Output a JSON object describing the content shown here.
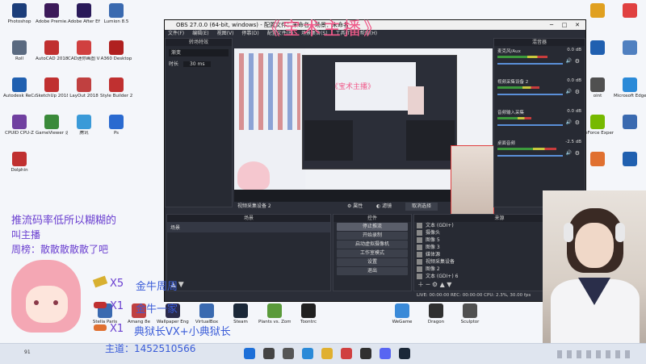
{
  "desktop_icons_left": [
    {
      "label": "Photoshop",
      "color": "#1b3d7a"
    },
    {
      "label": "Adobe Premie...",
      "color": "#3c1a5a"
    },
    {
      "label": "Adobe After Effects 2020",
      "color": "#2a1a5a"
    },
    {
      "label": "Lumion 8.5",
      "color": "#3a6ab0"
    },
    {
      "label": "Roll",
      "color": "#5a6a80"
    },
    {
      "label": "AutoCAD 2018 - Si...",
      "color": "#c03030"
    },
    {
      "label": "CAD迷你画图 V3.0",
      "color": "#d04040"
    },
    {
      "label": "A360 Desktop",
      "color": "#b02020"
    },
    {
      "label": "Autodesk ReCap 2018",
      "color": "#2060b0"
    },
    {
      "label": "SketchUp 2018",
      "color": "#c03030"
    },
    {
      "label": "LayOut 2018",
      "color": "#c04040"
    },
    {
      "label": "Style Builder 2018",
      "color": "#c03030"
    },
    {
      "label": "CPUID CPU-Z",
      "color": "#7040a0"
    },
    {
      "label": "GameViewer 远程",
      "color": "#3a8a3a"
    },
    {
      "label": "腾讯",
      "color": "#3a9ad8"
    },
    {
      "label": "Ps",
      "color": "#2a6ad0"
    },
    {
      "label": "Dolphin",
      "color": "#c03030"
    }
  ],
  "desktop_icons_right": [
    {
      "label": "",
      "color": "#e0a020"
    },
    {
      "label": "",
      "color": "#e04040"
    },
    {
      "label": "",
      "color": "#2060b0"
    },
    {
      "label": "",
      "color": "#5080c0"
    },
    {
      "label": "oint",
      "color": "#505050"
    },
    {
      "label": "Microsoft Edge",
      "color": "#2a8ad8"
    },
    {
      "label": "GeForce Experience",
      "color": "#76b900"
    },
    {
      "label": "",
      "color": "#3a6ab0"
    },
    {
      "label": "",
      "color": "#e07030"
    },
    {
      "label": "",
      "color": "#2060b0"
    }
  ],
  "desktop_icons_bottom": [
    {
      "label": "Stella Paris",
      "color": "#3a6ab0"
    },
    {
      "label": "Amang 8e",
      "color": "#c04040"
    },
    {
      "label": "Wallpaper Engine",
      "color": "#2a2a4a"
    },
    {
      "label": "VirtualBox",
      "color": "#3a6ab0"
    },
    {
      "label": "Steam",
      "color": "#1b2838"
    },
    {
      "label": "Plants vs. Zombies...",
      "color": "#5a9a3a"
    },
    {
      "label": "Toontrc",
      "color": "#202020"
    },
    {
      "label": "WeGame",
      "color": "#3a8ad8"
    },
    {
      "label": "Dragon",
      "color": "#303030"
    },
    {
      "label": "Sculptor",
      "color": "#505050"
    }
  ],
  "overlay": {
    "room_title": "《宝术主播》",
    "room_title_small": "《宝术主播》",
    "line1": "推流码率低所以糊糊的",
    "line2": "叫主播",
    "line3": "周榜：散散散散散了吧",
    "gift1_count": "X5",
    "gift1_text": "金牛周周",
    "gift2_count": "X1",
    "gift2_text": "金牛一家",
    "gift3_count": "X1",
    "gift3_text": "典狱长VX+小典狱长",
    "room_id": "主道：1452510566"
  },
  "obs": {
    "title": "OBS 27.0.0 (64-bit, windows) - 配置文件：未命名 - 场景：未命名",
    "menu": [
      "文件(F)",
      "编辑(E)",
      "视图(V)",
      "停靠(D)",
      "配置文件(P)",
      "场景集合(S)",
      "工具(T)",
      "帮助(H)"
    ],
    "transition_panel_title": "转场特效",
    "transition_value": "渐变",
    "duration_label": "时长",
    "duration_value": "30 ms",
    "mixer_title": "混音器",
    "mixer": [
      {
        "name": "麦克风/Aux",
        "db": "0.0 dB",
        "level": 0.6
      },
      {
        "name": "视频采集设备 2",
        "db": "0.0 dB",
        "level": 0.5
      },
      {
        "name": "音频输入采集",
        "db": "0.0 dB",
        "level": 0.4
      },
      {
        "name": "桌面音频",
        "db": "-2.5 dB",
        "level": 0.7
      }
    ],
    "source_caption": "视频采集设备 2",
    "properties_button": "属性",
    "filters_button": "滤镜",
    "deselect_button": "取消选择",
    "scenes_title": "场景",
    "scene_item": "场景",
    "controls_title": "控件",
    "controls": [
      "停止推流",
      "开始录制",
      "启动虚拟摄像机",
      "工作室模式",
      "设置",
      "退出"
    ],
    "sources_title": "来源",
    "sources": [
      "文本 (GDI+)",
      "摄像头",
      "图像 5",
      "图像 3",
      "媒体源",
      "视频采集设备",
      "图像 2",
      "文本 (GDI+) 6"
    ],
    "status": "LIVE: 00:00:00   REC: 00:00:00   CPU: 2.3%, 30.00 fps"
  },
  "taskbar": {
    "icons": [
      "start-icon",
      "search-icon",
      "taskview-icon",
      "edge-icon",
      "file-explorer-icon",
      "app-icon",
      "obs-icon",
      "discord-icon",
      "steam-icon"
    ],
    "tray_count": "91"
  },
  "colors": {
    "overlay_purple": "#6a3fd0",
    "overlay_pink": "#f05a8a",
    "gift_blue": "#3a5cd8",
    "obs_bg": "#2b2e38"
  }
}
